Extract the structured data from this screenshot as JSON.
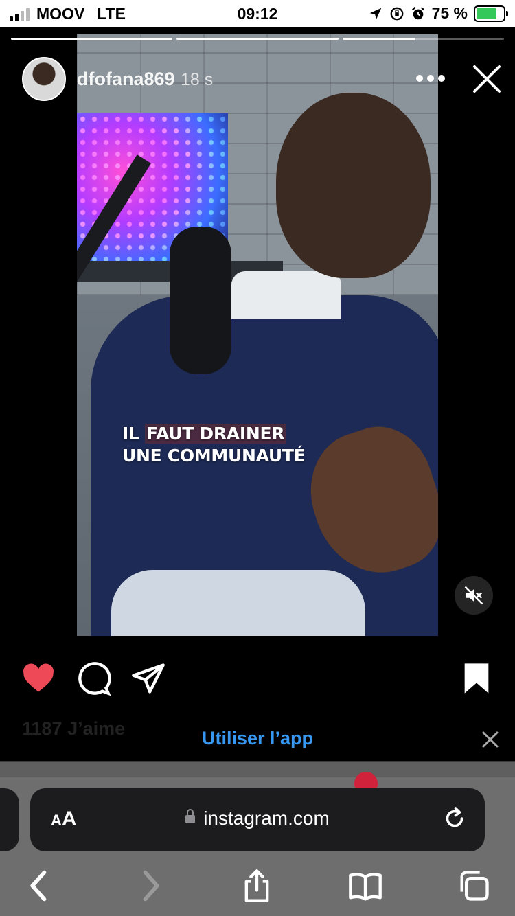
{
  "status_bar": {
    "carrier": "MOOV",
    "network": "LTE",
    "time": "09:12",
    "battery_percent": "75 %",
    "battery_level": 0.75,
    "icons": [
      "location-arrow-icon",
      "orientation-lock-icon",
      "alarm-icon",
      "battery-charging-icon"
    ]
  },
  "story": {
    "progress_segments": [
      1.0,
      1.0,
      0.45
    ],
    "username": "dfofana869",
    "time_ago": "18 s",
    "caption_line1_a": "IL ",
    "caption_line1_b": "FAUT DRAINER",
    "caption_line2": "UNE COMMUNAUTÉ",
    "muted": true
  },
  "actions": {
    "liked": true,
    "like_color": "#ed4956",
    "likes_text": "1187 J’aime",
    "use_app_label": "Utiliser l’app",
    "use_app_color": "#3897f0"
  },
  "browser": {
    "aa_big": "A",
    "aa_small": "A",
    "url": "instagram.com"
  }
}
